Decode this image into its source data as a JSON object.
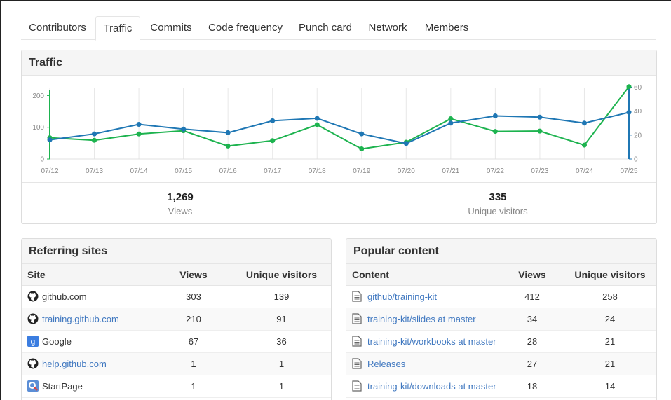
{
  "tabs": [
    {
      "label": "Contributors",
      "selected": false
    },
    {
      "label": "Traffic",
      "selected": true
    },
    {
      "label": "Commits",
      "selected": false
    },
    {
      "label": "Code frequency",
      "selected": false
    },
    {
      "label": "Punch card",
      "selected": false
    },
    {
      "label": "Network",
      "selected": false
    },
    {
      "label": "Members",
      "selected": false
    }
  ],
  "traffic": {
    "title": "Traffic",
    "views_total": "1,269",
    "views_label": "Views",
    "unique_total": "335",
    "unique_label": "Unique visitors"
  },
  "chart_data": {
    "type": "line",
    "x": [
      "07/12",
      "07/13",
      "07/14",
      "07/15",
      "07/16",
      "07/17",
      "07/18",
      "07/19",
      "07/20",
      "07/21",
      "07/22",
      "07/23",
      "07/24",
      "07/25"
    ],
    "series": [
      {
        "name": "Views",
        "axis": "left",
        "color": "#1db34f",
        "values": [
          67,
          59,
          79,
          89,
          41,
          58,
          108,
          32,
          53,
          127,
          87,
          88,
          44,
          228
        ]
      },
      {
        "name": "Unique visitors",
        "axis": "right",
        "color": "#1f77b4",
        "values": [
          16,
          21,
          29,
          25,
          22,
          32,
          34,
          21,
          13,
          30,
          36,
          35,
          30,
          39
        ]
      }
    ],
    "y_left": {
      "ticks": [
        0,
        100,
        200
      ],
      "lim": [
        0,
        245
      ]
    },
    "y_right": {
      "ticks": [
        0,
        20,
        40,
        60
      ],
      "lim": [
        0,
        65
      ]
    },
    "grid": "vertical"
  },
  "referring": {
    "title": "Referring sites",
    "columns": [
      "Site",
      "Views",
      "Unique visitors"
    ],
    "rows": [
      {
        "site": "github.com",
        "icon": "github-octocat-icon",
        "link": false,
        "views": "303",
        "unique": "139"
      },
      {
        "site": "training.github.com",
        "icon": "github-octocat-icon",
        "link": true,
        "views": "210",
        "unique": "91"
      },
      {
        "site": "Google",
        "icon": "google-icon",
        "link": false,
        "views": "67",
        "unique": "36"
      },
      {
        "site": "help.github.com",
        "icon": "github-octocat-icon",
        "link": true,
        "views": "1",
        "unique": "1"
      },
      {
        "site": "StartPage",
        "icon": "startpage-icon",
        "link": false,
        "views": "1",
        "unique": "1"
      }
    ]
  },
  "popular": {
    "title": "Popular content",
    "columns": [
      "Content",
      "Views",
      "Unique visitors"
    ],
    "rows": [
      {
        "path": "github/training-kit",
        "views": "412",
        "unique": "258"
      },
      {
        "path": "training-kit/slides at master",
        "views": "34",
        "unique": "24"
      },
      {
        "path": "training-kit/workbooks at master",
        "views": "28",
        "unique": "21"
      },
      {
        "path": "Releases",
        "views": "27",
        "unique": "21"
      },
      {
        "path": "training-kit/downloads at master",
        "views": "18",
        "unique": "14"
      }
    ]
  }
}
